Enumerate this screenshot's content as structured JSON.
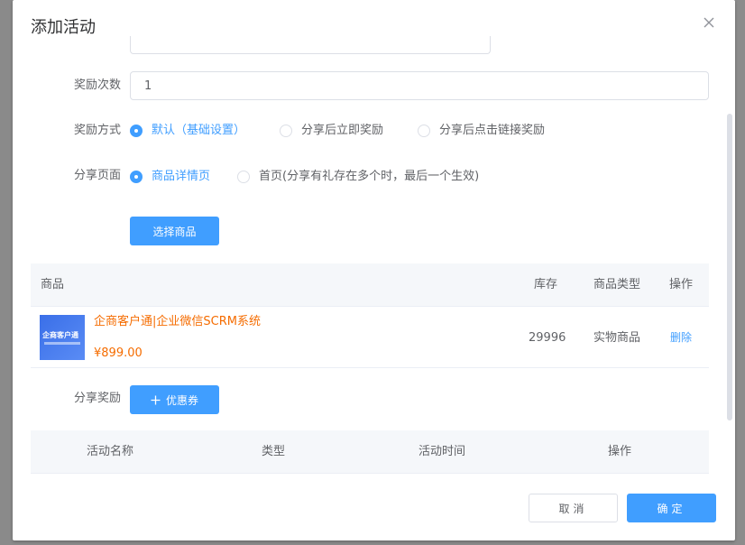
{
  "dialog": {
    "title": "添加活动"
  },
  "form": {
    "reward_count": {
      "label": "奖励次数",
      "value": "1"
    },
    "reward_method": {
      "label": "奖励方式",
      "options": [
        {
          "label": "默认（基础设置）",
          "checked": true
        },
        {
          "label": "分享后立即奖励",
          "checked": false
        },
        {
          "label": "分享后点击链接奖励",
          "checked": false
        }
      ]
    },
    "share_page": {
      "label": "分享页面",
      "options": [
        {
          "label": "商品详情页",
          "checked": true
        },
        {
          "label": "首页(分享有礼存在多个时，最后一个生效)",
          "checked": false
        }
      ]
    },
    "select_product_label": "选择商品",
    "share_reward": {
      "label": "分享奖励",
      "coupon_button": "优惠券"
    }
  },
  "product_table": {
    "headers": {
      "product": "商品",
      "stock": "库存",
      "type": "商品类型",
      "action": "操作"
    },
    "rows": [
      {
        "thumb_text": "企商客户通",
        "name": "企商客户通|企业微信SCRM系统",
        "price": "¥899.00",
        "stock": "29996",
        "type": "实物商品",
        "action": "删除"
      }
    ]
  },
  "activity_table": {
    "headers": {
      "name": "活动名称",
      "type": "类型",
      "time": "活动时间",
      "action": "操作"
    }
  },
  "footer": {
    "cancel": "取消",
    "confirm": "确定"
  },
  "colors": {
    "primary": "#409eff",
    "price": "#f56c00",
    "text": "#606266",
    "header_bg": "#f5f7fa"
  }
}
